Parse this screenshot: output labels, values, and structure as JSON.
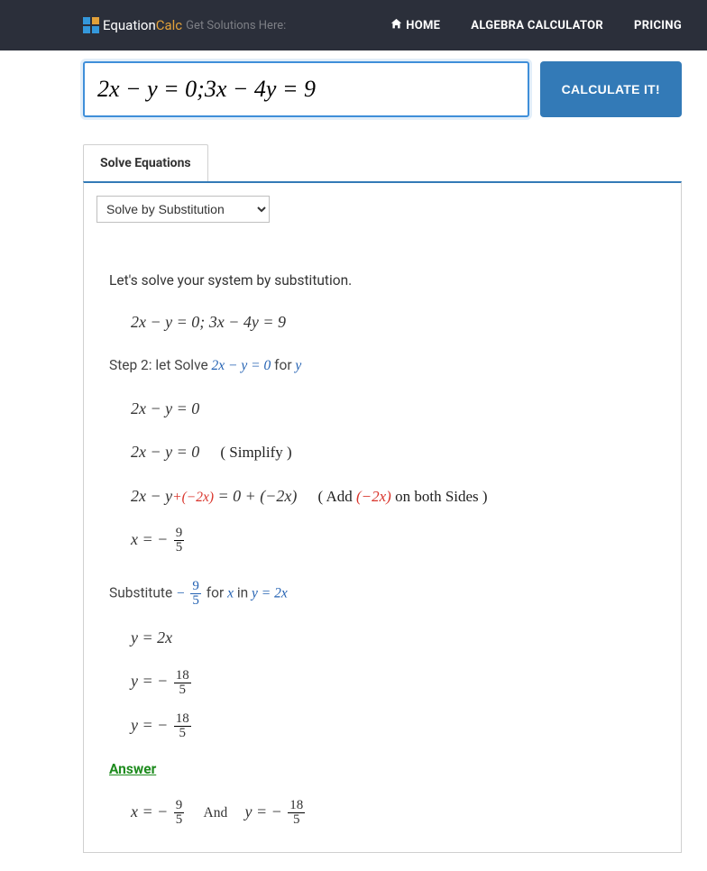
{
  "nav": {
    "logo_part1": "Equation",
    "logo_part2": "Calc",
    "tagline": "Get Solutions Here:",
    "home": "HOME",
    "algebra": "ALGEBRA CALCULATOR",
    "pricing": "PRICING"
  },
  "input": {
    "equation": "2x − y = 0;3x − 4y = 9",
    "calculate": "CALCULATE IT!"
  },
  "tabs": {
    "solve": "Solve Equations"
  },
  "method": {
    "selected": "Solve by Substitution"
  },
  "solution": {
    "intro": "Let's solve your system by substitution.",
    "system": "2x − y = 0;   3x − 4y = 9",
    "step2_pre": "Step 2: let Solve ",
    "step2_eq": "2x − y = 0",
    "step2_for": " for ",
    "step2_var": "y",
    "l1": "2x − y = 0",
    "l2a": "2x − y = 0",
    "l2b": "( Simplify )",
    "l3a_pre": "2x − y",
    "l3a_red": "+(−2x)",
    "l3a_post": " = 0 + (−2x)",
    "l3b_pre": "( Add  ",
    "l3b_red": "(−2x)",
    "l3b_post": "  on both Sides )",
    "l4_pre": "x = − ",
    "l4_num": "9",
    "l4_den": "5",
    "sub_pre": "Substitute ",
    "sub_neg": "− ",
    "sub_num": "9",
    "sub_den": "5",
    "sub_for": " for ",
    "sub_x": "x",
    "sub_in": " in ",
    "sub_eq": "y = 2x",
    "s1": "y = 2x",
    "s2_pre": "y = − ",
    "s2_num": "18",
    "s2_den": "5",
    "s3_pre": "y = − ",
    "s3_num": "18",
    "s3_den": "5",
    "answer_label": "Answer",
    "fx_pre": "x = − ",
    "fx_num": "9",
    "fx_den": "5",
    "and": "And",
    "fy_pre": "y = − ",
    "fy_num": "18",
    "fy_den": "5"
  }
}
